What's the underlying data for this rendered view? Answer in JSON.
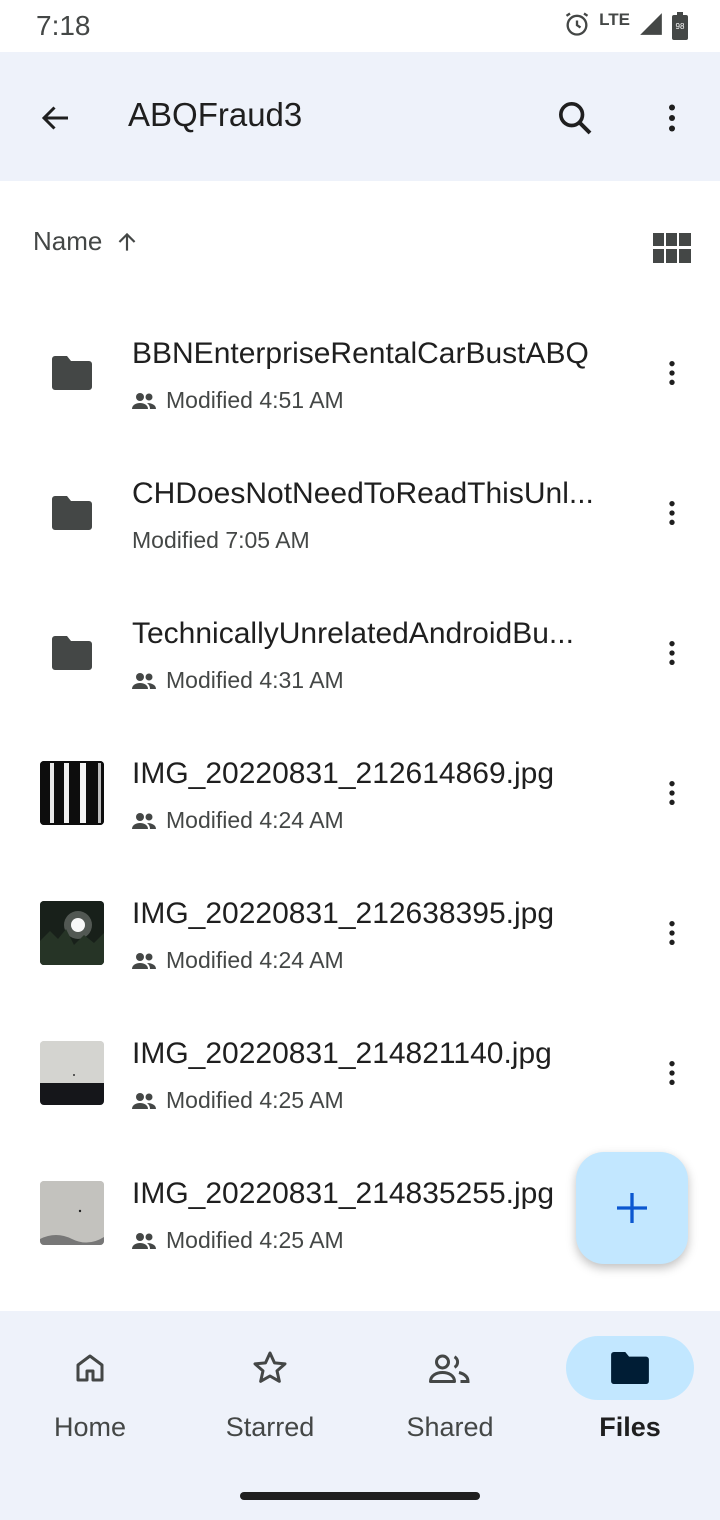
{
  "status_bar": {
    "time": "7:18",
    "network": "LTE",
    "battery_level": "98"
  },
  "app_bar": {
    "title": "ABQFraud3",
    "icons": [
      "back-arrow-icon",
      "search-icon",
      "more-vert-icon"
    ]
  },
  "sort": {
    "label": "Name",
    "direction_icon": "arrow-up-icon",
    "view_toggle_icon": "grid-view-icon"
  },
  "files": [
    {
      "name": "BBNEnterpriseRentalCarBustABQ",
      "modified": "Modified 4:51 AM",
      "shared": true,
      "type": "folder"
    },
    {
      "name": "CHDoesNotNeedToReadThisUnl...",
      "modified": "Modified 7:05 AM",
      "shared": false,
      "type": "folder"
    },
    {
      "name": "TechnicallyUnrelatedAndroidBu...",
      "modified": "Modified 4:31 AM",
      "shared": true,
      "type": "folder"
    },
    {
      "name": "IMG_20220831_212614869.jpg",
      "modified": "Modified 4:24 AM",
      "shared": true,
      "type": "image"
    },
    {
      "name": "IMG_20220831_212638395.jpg",
      "modified": "Modified 4:24 AM",
      "shared": true,
      "type": "image"
    },
    {
      "name": "IMG_20220831_214821140.jpg",
      "modified": "Modified 4:25 AM",
      "shared": true,
      "type": "image"
    },
    {
      "name": "IMG_20220831_214835255.jpg",
      "modified": "Modified 4:25 AM",
      "shared": true,
      "type": "image"
    }
  ],
  "fab": {
    "icon": "plus-icon"
  },
  "bottom_nav": {
    "items": [
      {
        "label": "Home",
        "icon": "home-icon",
        "active": false
      },
      {
        "label": "Starred",
        "icon": "star-icon",
        "active": false
      },
      {
        "label": "Shared",
        "icon": "people-icon",
        "active": false
      },
      {
        "label": "Files",
        "icon": "folder-icon",
        "active": true
      }
    ]
  },
  "colors": {
    "app_bar_bg": "#eef2fa",
    "accent": "#c2e7ff",
    "text_primary": "#1f1f1f",
    "text_secondary": "#444746"
  }
}
